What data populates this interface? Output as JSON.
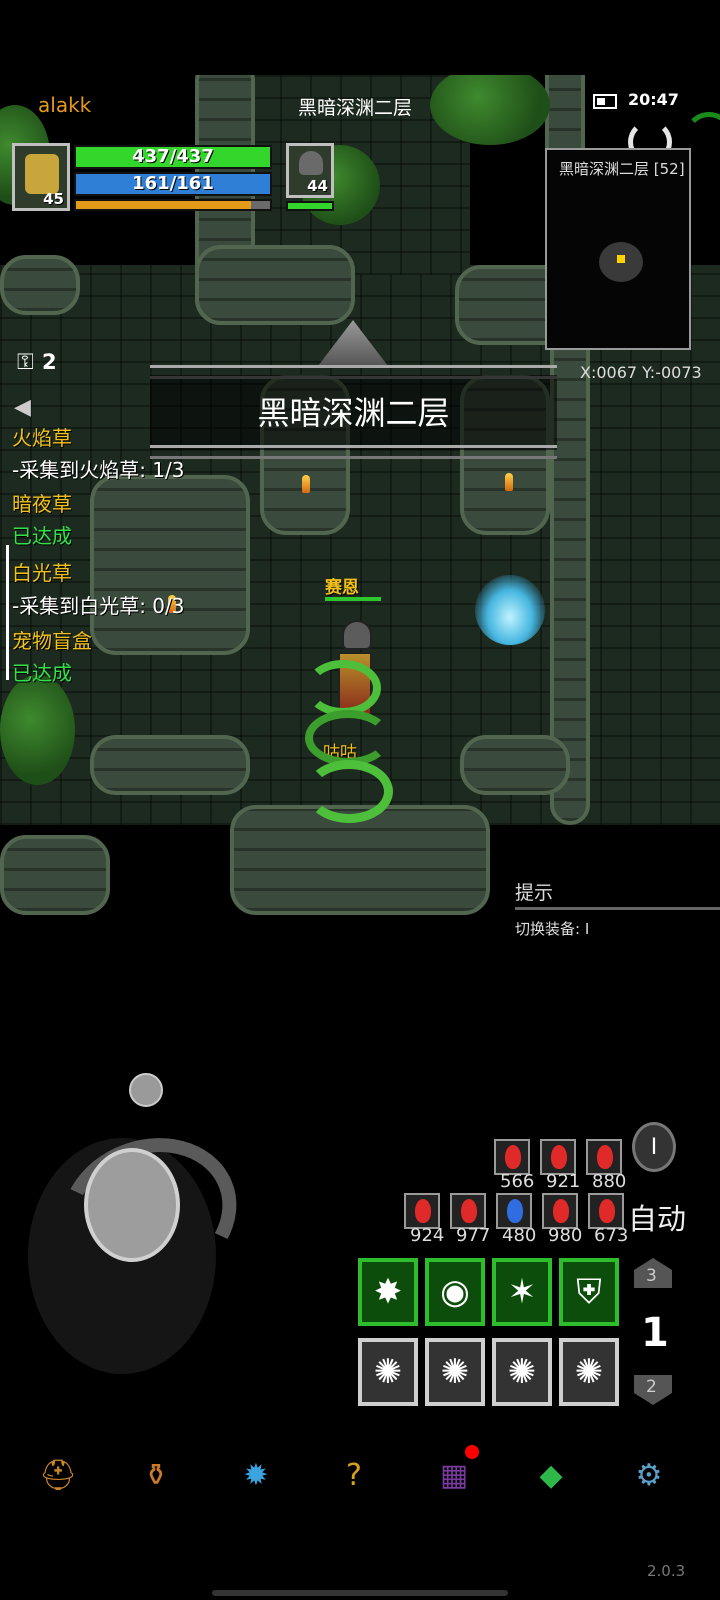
{
  "player": {
    "name": "alakk",
    "hp": "437/437",
    "mp": "161/161",
    "level": "45",
    "xp_fraction": 0.9
  },
  "pet": {
    "level": "44"
  },
  "location": {
    "title": "黑暗深渊二层",
    "banner": "黑暗深渊二层",
    "minimap_label": "黑暗深渊二层 [52]",
    "coords": "X:0067 Y:-0073"
  },
  "status": {
    "time": "20:47"
  },
  "keys": {
    "count": "2"
  },
  "quests": [
    {
      "text": "火焰草",
      "color": "#f2c21b"
    },
    {
      "text": "-采集到火焰草: 1/3",
      "color": "#ffffff"
    },
    {
      "text": "暗夜草",
      "color": "#f2c21b"
    },
    {
      "text": "已达成",
      "color": "#33e14a"
    },
    {
      "text": "白光草",
      "color": "#f2c21b"
    },
    {
      "text": "-采集到白光草: 0/3",
      "color": "#ffffff"
    },
    {
      "text": "宠物盲盒",
      "color": "#f2c21b"
    },
    {
      "text": "已达成",
      "color": "#33e14a"
    }
  ],
  "npcs": {
    "knight_name": "赛恩",
    "pet_name": "咕咕"
  },
  "hint": {
    "title": "提示",
    "text": "切换装备: I"
  },
  "potions_row1": [
    {
      "count": "566",
      "color": "#e02a2a"
    },
    {
      "count": "921",
      "color": "#e02a2a"
    },
    {
      "count": "880",
      "color": "#e02a2a"
    }
  ],
  "potions_row2": [
    {
      "count": "924",
      "color": "#e02a2a"
    },
    {
      "count": "977",
      "color": "#e02a2a"
    },
    {
      "count": "480",
      "color": "#2f6de0"
    },
    {
      "count": "980",
      "color": "#e02a2a"
    },
    {
      "count": "673",
      "color": "#e02a2a"
    }
  ],
  "controls": {
    "auto_label": "自动",
    "page_up": "3",
    "page_current": "1",
    "page_down": "2"
  },
  "skills_row1": [
    "skill-claw-icon",
    "skill-orb-icon",
    "skill-burst-icon",
    "skill-shield-icon"
  ],
  "skills_row2": [
    "empty-slot-icon",
    "empty-slot-icon",
    "empty-slot-icon",
    "empty-slot-icon"
  ],
  "nav": [
    "helmet-icon",
    "bag-icon",
    "gem-blue-icon",
    "help-icon",
    "book-icon",
    "emerald-icon",
    "settings-icon"
  ],
  "version": "2.0.3"
}
